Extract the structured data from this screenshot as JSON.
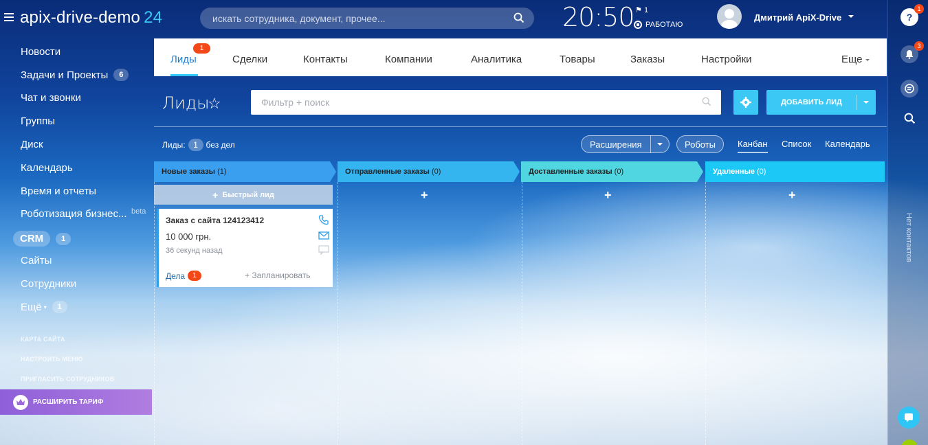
{
  "header": {
    "logo": "apix-drive-demo",
    "logo_num": "24",
    "search_placeholder": "искать сотрудника, документ, прочее...",
    "clock": "20:50",
    "flag_count": "1",
    "work_status": "РАБОТАЮ",
    "user_name": "Дмитрий ApiX-Drive"
  },
  "right_panel": {
    "help_badge": "1",
    "notif_badge": "3",
    "vertical_text": "Нет контактов"
  },
  "sidebar": {
    "items": [
      {
        "label": "Новости",
        "count": ""
      },
      {
        "label": "Задачи и Проекты",
        "count": "6"
      },
      {
        "label": "Чат и звонки",
        "count": ""
      },
      {
        "label": "Группы",
        "count": ""
      },
      {
        "label": "Диск",
        "count": ""
      },
      {
        "label": "Календарь",
        "count": ""
      },
      {
        "label": "Время и отчеты",
        "count": ""
      },
      {
        "label": "Роботизация бизнес...",
        "count": ""
      },
      {
        "label": "CRM",
        "count": "1"
      },
      {
        "label": "Сайты",
        "count": ""
      },
      {
        "label": "Сотрудники",
        "count": ""
      },
      {
        "label": "Ещё",
        "count": "1"
      }
    ],
    "beta": "beta",
    "links": [
      "КАРТА САЙТА",
      "НАСТРОИТЬ МЕНЮ",
      "ПРИГЛАСИТЬ СОТРУДНИКОВ"
    ],
    "upgrade": "РАСШИРИТЬ ТАРИФ"
  },
  "tabs": {
    "items": [
      "Лиды",
      "Сделки",
      "Контакты",
      "Компании",
      "Аналитика",
      "Товары",
      "Заказы",
      "Настройки"
    ],
    "badge": "1",
    "more": "Еще"
  },
  "toolbar": {
    "title": "Лиды",
    "filter_placeholder": "Фильтр + поиск",
    "add_button": "ДОБАВИТЬ ЛИД"
  },
  "subbar": {
    "leads_label": "Лиды:",
    "leads_count": "1",
    "leads_suffix": "без дел",
    "extensions": "Расширения",
    "robots": "Роботы",
    "views": [
      "Канбан",
      "Список",
      "Календарь"
    ]
  },
  "kanban": {
    "columns": [
      {
        "name": "Новые заказы",
        "count": "(1)",
        "color": "#3b9ff0"
      },
      {
        "name": "Отправленные заказы",
        "count": "(0)",
        "color": "#34b5f0"
      },
      {
        "name": "Доставленные заказы",
        "count": "(0)",
        "color": "#4fd6e0"
      },
      {
        "name": "Удаленные",
        "count": "(0)",
        "color": "#1cc8f5"
      }
    ],
    "quick_lead": "Быстрый лид",
    "card": {
      "title": "Заказ с сайта 124123412",
      "price": "10 000 грн.",
      "time": "36 секунд назад",
      "deals": "Дела",
      "deals_badge": "1",
      "plan": "+ Запланировать"
    }
  }
}
